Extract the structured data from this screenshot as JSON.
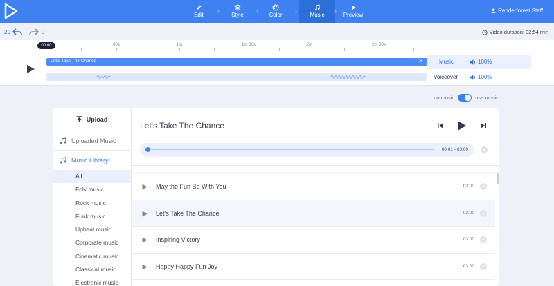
{
  "nav": {
    "steps": [
      {
        "label": "Edit",
        "icon": "pencil-icon"
      },
      {
        "label": "Style",
        "icon": "layers-icon"
      },
      {
        "label": "Color",
        "icon": "palette-icon"
      },
      {
        "label": "Music",
        "icon": "music-note-icon"
      },
      {
        "label": "Preview",
        "icon": "play-icon"
      }
    ],
    "active": "Music",
    "user": "Renderforest Staff"
  },
  "history": {
    "undo_count": "20",
    "redo_count": "0",
    "duration": "Video duration: 02:54 min"
  },
  "timeline": {
    "current_time": "00:00",
    "ticks": [
      "30s",
      "1m",
      "1m 30s",
      "2m",
      "2m 30s"
    ],
    "music_track": {
      "title": "Let's Take The Chance",
      "name": "Music",
      "volume": "100%"
    },
    "voiceover_track": {
      "name": "Voiceover",
      "volume": "100%"
    }
  },
  "toggle": {
    "off_label": "no music",
    "on_label": "use music",
    "enabled": true
  },
  "sidebar": {
    "upload": "Upload",
    "uploaded": "Uploaded Music",
    "library": "Music Library",
    "categories": [
      "All",
      "Folk music",
      "Rock music",
      "Funk music",
      "Upbeat music",
      "Corporate music",
      "Cinematic music",
      "Classical music",
      "Electronic music"
    ]
  },
  "player": {
    "title": "Let's Take The Chance",
    "time": "00:01 - 03:00"
  },
  "songs": [
    {
      "name": "May the Fun Be With You",
      "duration": "03:00"
    },
    {
      "name": "Let's Take The Chance",
      "duration": "03:00"
    },
    {
      "name": "Inspiring Victory",
      "duration": "03:00"
    },
    {
      "name": "Happy Happy Fun Joy",
      "duration": "03:00"
    }
  ],
  "colors": {
    "accent": "#3d82f0",
    "active_tab": "#2b6fd9"
  }
}
